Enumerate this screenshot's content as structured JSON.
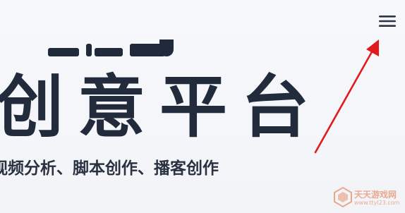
{
  "header": {
    "menu_icon": "hamburger-menu-icon"
  },
  "hero": {
    "headline": "创意平台",
    "subtitle": "视频分析、脚本创作、播客创作"
  },
  "watermark": {
    "name": "天天游戏网",
    "url": "www.ttyl23.com"
  },
  "colors": {
    "text_dark": "#222b3c",
    "annotation_red": "#e01b1b",
    "watermark_orange": "#e46a3a",
    "background": "#f4f6fa"
  }
}
